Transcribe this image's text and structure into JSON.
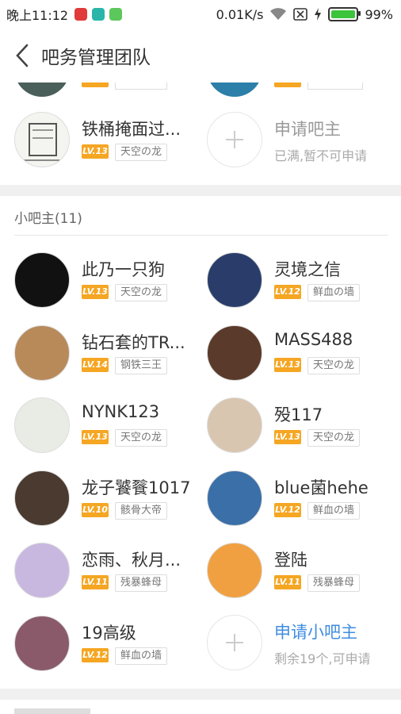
{
  "status_bar": {
    "time": "晚上11:12",
    "speed": "0.01K/s",
    "battery_percent": "99%",
    "battery_level": 0.99
  },
  "nav": {
    "title": "吧务管理团队"
  },
  "top_section": {
    "members": [
      {
        "name": "铁桶掩面过...",
        "level": "LV.13",
        "title": "天空の龙"
      }
    ],
    "apply": {
      "title": "申请吧主",
      "subtitle": "已满,暂不可申请"
    }
  },
  "small_owner_section": {
    "header": "小吧主(11)",
    "members": [
      {
        "name": "此乃一只狗",
        "level": "LV.13",
        "title": "天空の龙"
      },
      {
        "name": "灵境之信",
        "level": "LV.12",
        "title": "鲜血の墙"
      },
      {
        "name": "钻石套的TR...",
        "level": "LV.14",
        "title": "钢铁三王"
      },
      {
        "name": "MASS488",
        "level": "LV.13",
        "title": "天空の龙"
      },
      {
        "name": "NYNK123",
        "level": "LV.13",
        "title": "天空の龙"
      },
      {
        "name": "殁117",
        "level": "LV.13",
        "title": "天空の龙"
      },
      {
        "name": "龙子饕餮1017",
        "level": "LV.10",
        "title": "骸骨大帝"
      },
      {
        "name": "blue菌hehe",
        "level": "LV.12",
        "title": "鲜血の墙"
      },
      {
        "name": "恋雨、秋月...",
        "level": "LV.11",
        "title": "残暴蜂母"
      },
      {
        "name": "登陆",
        "level": "LV.11",
        "title": "残暴蜂母"
      },
      {
        "name": "19高级",
        "level": "LV.12",
        "title": "鲜血の墙"
      }
    ],
    "apply": {
      "title": "申请小吧主",
      "subtitle": "剩余19个,可申请"
    }
  },
  "colors": {
    "level_badge": "#f5a623",
    "link_blue": "#3f8de0",
    "divider": "#f0f0f0"
  }
}
